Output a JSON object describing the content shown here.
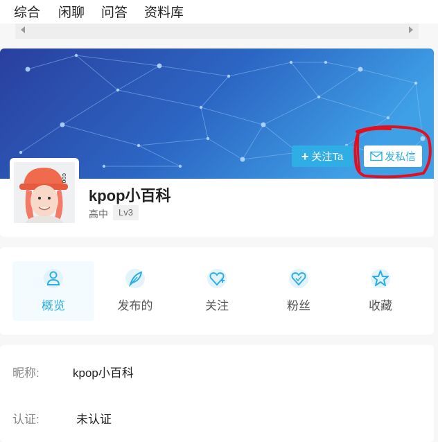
{
  "top_tabs": [
    "综合",
    "闲聊",
    "问答",
    "资料库"
  ],
  "profile": {
    "follow_label": "关注Ta",
    "message_label": "发私信",
    "username": "kpop小百科",
    "grade": "高中",
    "level": "Lv3",
    "avatar_text": "coo"
  },
  "nav": [
    {
      "label": "概览",
      "icon": "person-icon",
      "active": true
    },
    {
      "label": "发布的",
      "icon": "feather-icon",
      "active": false
    },
    {
      "label": "关注",
      "icon": "heart-plus-icon",
      "active": false
    },
    {
      "label": "粉丝",
      "icon": "heart-icon",
      "active": false
    },
    {
      "label": "收藏",
      "icon": "star-icon",
      "active": false
    }
  ],
  "info": {
    "nickname_label": "昵称:",
    "nickname_value": "kpop小百科",
    "cert_label": "认证:",
    "cert_value": "未认证"
  },
  "colors": {
    "accent": "#2eaee4",
    "banner": "#2b5dbd",
    "annotation": "#e01020"
  }
}
